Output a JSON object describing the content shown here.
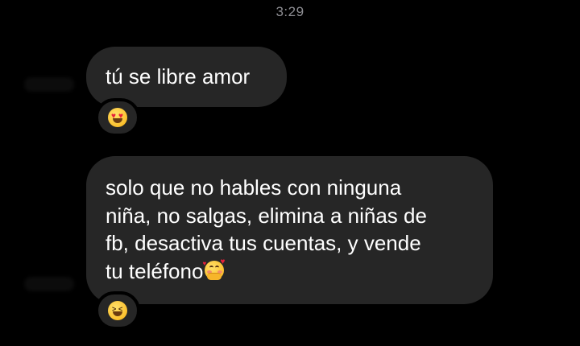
{
  "header": {
    "timestamp": "3:29"
  },
  "messages": [
    {
      "text": "tú se libre amor",
      "reaction": {
        "icon": "heart-eyes-emoji"
      }
    },
    {
      "lines": [
        "solo que no hables con ninguna",
        "niña, no salgas, elimina a niñas de",
        "fb, desactiva tus cuentas, y vende",
        "tu teléfono"
      ],
      "inline_icon": "smiling-face-with-hearts-emoji",
      "reaction": {
        "icon": "laughing-squint-emoji"
      }
    }
  ],
  "colors": {
    "background": "#000000",
    "bubble": "#262626",
    "text": "#ffffff",
    "timestamp": "#8e8e93"
  }
}
